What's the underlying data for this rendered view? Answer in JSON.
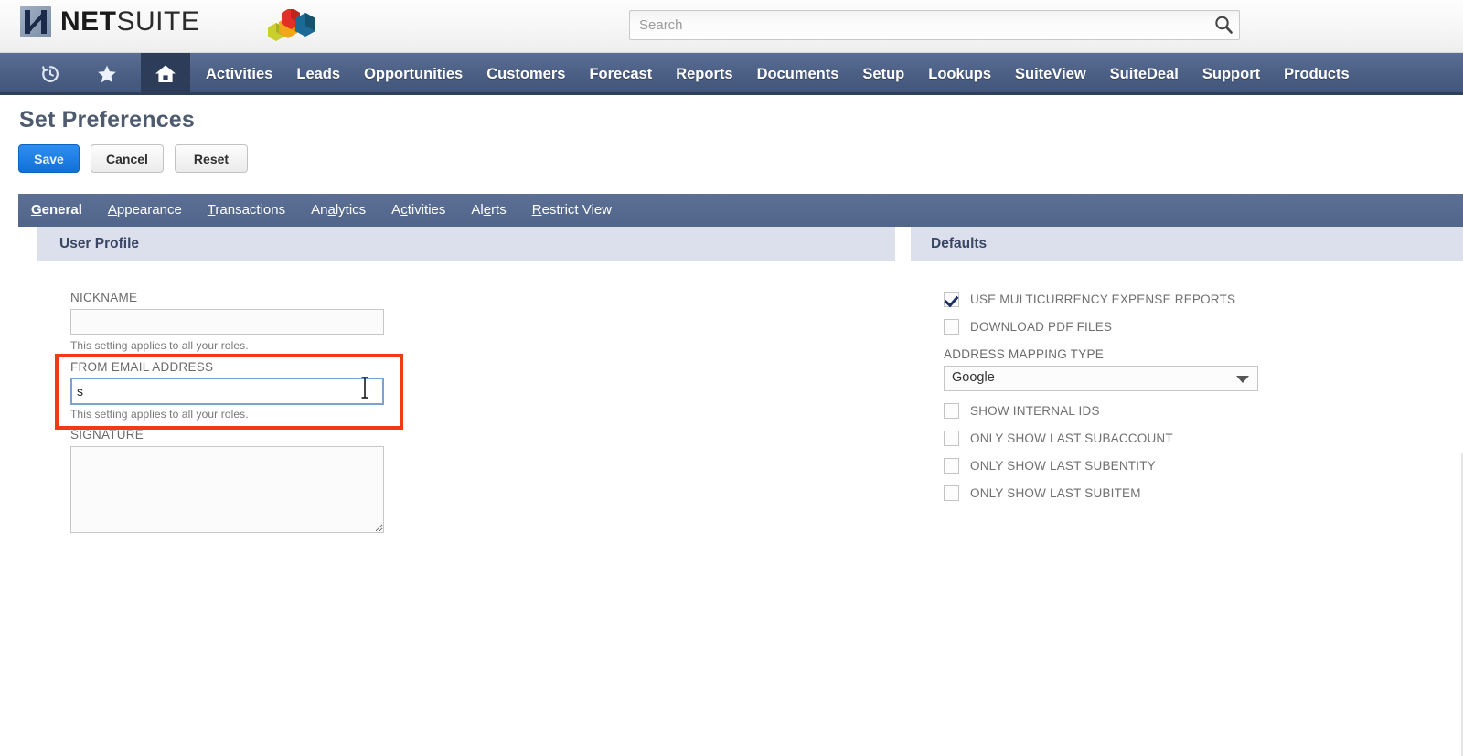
{
  "brand": {
    "logo_bold": "NET",
    "logo_light": "SUITE",
    "logo_mark": "netsuite-n-mark",
    "cube_logo": "netsuite-cubes-logo"
  },
  "search": {
    "placeholder": "Search",
    "value": "",
    "icon": "search-icon"
  },
  "mainnav": {
    "icons": [
      {
        "name": "history-clock-icon",
        "glyph": "↺"
      },
      {
        "name": "favorites-star-icon",
        "glyph": "★"
      },
      {
        "name": "home-icon",
        "glyph": "⌂"
      }
    ],
    "links": [
      "Activities",
      "Leads",
      "Opportunities",
      "Customers",
      "Forecast",
      "Reports",
      "Documents",
      "Setup",
      "Lookups",
      "SuiteView",
      "SuiteDeal",
      "Support",
      "Products"
    ]
  },
  "page": {
    "title": "Set Preferences",
    "buttons": {
      "save": "Save",
      "cancel": "Cancel",
      "reset": "Reset"
    }
  },
  "tabs": [
    {
      "pre": "",
      "ak": "G",
      "post": "eneral",
      "active": true
    },
    {
      "pre": "",
      "ak": "A",
      "post": "ppearance",
      "active": false
    },
    {
      "pre": "",
      "ak": "T",
      "post": "ransactions",
      "active": false
    },
    {
      "pre": "An",
      "ak": "a",
      "post": "lytics",
      "active": false
    },
    {
      "pre": "A",
      "ak": "c",
      "post": "tivities",
      "active": false
    },
    {
      "pre": "Al",
      "ak": "e",
      "post": "rts",
      "active": false
    },
    {
      "pre": "",
      "ak": "R",
      "post": "estrict View",
      "active": false
    }
  ],
  "left_panel": {
    "header": "User Profile",
    "nickname": {
      "label": "NICKNAME",
      "value": "",
      "help": "This setting applies to all your roles."
    },
    "from_email": {
      "label": "FROM EMAIL ADDRESS",
      "value": "s",
      "help": "This setting applies to all your roles.",
      "highlighted": true,
      "highlight_color": "#f03a17",
      "focus_border_color": "#7aa4cf"
    },
    "signature": {
      "label": "SIGNATURE",
      "value": ""
    }
  },
  "right_panel": {
    "header": "Defaults",
    "checkboxes_top": [
      {
        "label": "USE MULTICURRENCY EXPENSE REPORTS",
        "checked": true
      },
      {
        "label": "DOWNLOAD PDF FILES",
        "checked": false
      }
    ],
    "address_mapping": {
      "label": "ADDRESS MAPPING TYPE",
      "value": "Google",
      "arrow_icon": "chevron-down-icon"
    },
    "checkboxes_bottom": [
      {
        "label": "SHOW INTERNAL IDS",
        "checked": false
      },
      {
        "label": "ONLY SHOW LAST SUBACCOUNT",
        "checked": false
      },
      {
        "label": "ONLY SHOW LAST SUBENTITY",
        "checked": false
      },
      {
        "label": "ONLY SHOW LAST SUBITEM",
        "checked": false
      }
    ]
  },
  "cursor": {
    "name": "text-i-beam-cursor"
  },
  "colors": {
    "nav_blue": "#4d6187",
    "tab_blue": "#51658b",
    "panel_header": "#dcdfec",
    "save_blue": "#1071d8",
    "highlight_red": "#f03a17"
  }
}
